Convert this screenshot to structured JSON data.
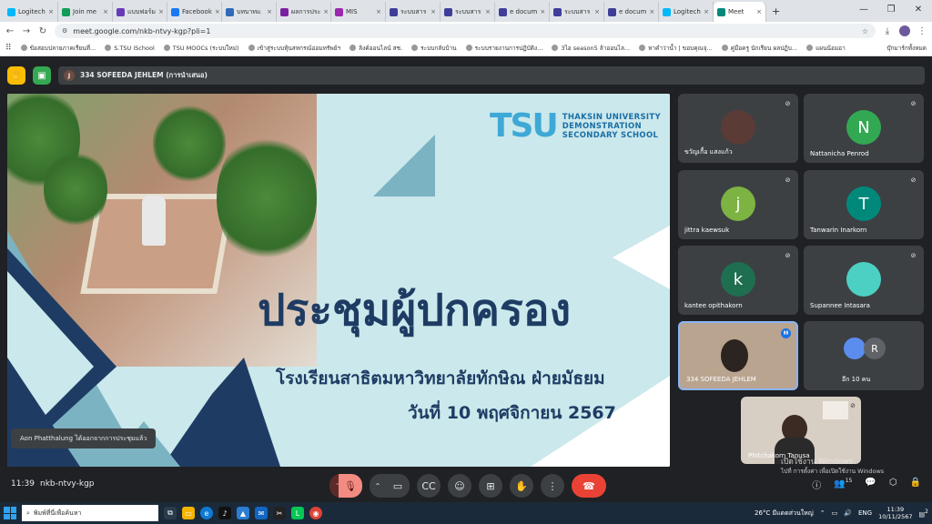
{
  "browser": {
    "tabs": [
      {
        "label": "Logitech",
        "color": "#00b8fc"
      },
      {
        "label": "Join me",
        "color": "#0f9d58"
      },
      {
        "label": "แบบฟอร์ม",
        "color": "#673ab7"
      },
      {
        "label": "Facebook",
        "color": "#1877f2"
      },
      {
        "label": "บทบาทแ",
        "color": "#2e6ab8"
      },
      {
        "label": "ผลการประ",
        "color": "#7b1fa2"
      },
      {
        "label": "MIS",
        "color": "#9c27b0"
      },
      {
        "label": "ระบบสาร",
        "color": "#3f3d99"
      },
      {
        "label": "ระบบสาร",
        "color": "#3f3d99"
      },
      {
        "label": "e docum",
        "color": "#3f3d99"
      },
      {
        "label": "ระบบสาร",
        "color": "#3f3d99"
      },
      {
        "label": "e docum",
        "color": "#3f3d99"
      },
      {
        "label": "Logitech",
        "color": "#00b8fc"
      },
      {
        "label": "Meet",
        "color": "#00897b"
      }
    ],
    "new_tab": "+",
    "url": "meet.google.com/nkb-ntvy-kgp?pli=1",
    "bookmarks": [
      "ข้อสอบปลายภาคเรียนที่...",
      "S.TSU iSchool",
      "TSU MOOCs (ระบบใหม่)",
      "เข้าสู่ระบบหุ้นสหกรณ์ออมทรัพย์ฯ",
      "ลิงค์ออนไลน์ สช.",
      "ระบบกลับบ้าน",
      "ระบบรายงานการปฏิบัติง...",
      "3ไอ season5 ล้าออนไล...",
      "หาคำว่าน้ำ | ขอบคุณจุ...",
      "คู่มือครู นักเรียน ผลปฏิบ...",
      "แผนน้อมอา"
    ],
    "bookmarks_right": "บุ๊กมาร์กทั้งหมด"
  },
  "meet": {
    "presenter_label": "334 SOFEEDA JEHLEM (การนำเสนอ)",
    "presenter_initial": "J",
    "slide": {
      "logo_letters": "TSU",
      "logo_line1": "THAKSIN UNIVERSITY",
      "logo_line2": "DEMONSTRATION",
      "logo_line3": "SECONDARY SCHOOL",
      "title": "ประชุมผู้ปกครอง",
      "subtitle": "โรงเรียนสาธิตมหาวิทยาลัยทักษิณ ฝ่ายมัธยม",
      "date": "วันที่ 10 พฤศจิกายน 2567"
    },
    "toast": "Aon Phatthalung ได้ออกจากการประชุมแล้ว",
    "participants": [
      {
        "name": "ขวัญเกื้อ แสงแก้ว",
        "initial": "",
        "color": "#5a3b35"
      },
      {
        "name": "Nattanicha Penrod",
        "initial": "N",
        "color": "#33a852"
      },
      {
        "name": "jittra kaewsuk",
        "initial": "j",
        "color": "#7cb342"
      },
      {
        "name": "Tanwarin Inarkorn",
        "initial": "T",
        "color": "#00897b"
      },
      {
        "name": "kantee opithakorn",
        "initial": "k",
        "color": "#1e6e50"
      },
      {
        "name": "Supannee Intasara",
        "initial": "",
        "color": "#4dd0c4"
      },
      {
        "name": "334 SOFEEDA JEHLEM",
        "initial": "",
        "color": "#9a7b62"
      },
      {
        "name": "อีก 10 คน",
        "initial": "R",
        "color": "#5f6368"
      }
    ],
    "self_name": "Phitchakorn Tanusa",
    "time": "11:39",
    "meeting_code": "nkb-ntvy-kgp",
    "watermark_line1": "เปิดใช้งาน Windows",
    "watermark_line2": "ไปที่ การตั้งค่า เพื่อเปิดใช้งาน Windows",
    "people_count": "15"
  },
  "taskbar": {
    "search_placeholder": "พิมพ์ที่นี่เพื่อค้นหา",
    "weather": "26°C  มีแดดส่วนใหญ่",
    "lang": "ENG",
    "clock_time": "11:39",
    "clock_date": "10/11/2567",
    "notif": "2"
  }
}
